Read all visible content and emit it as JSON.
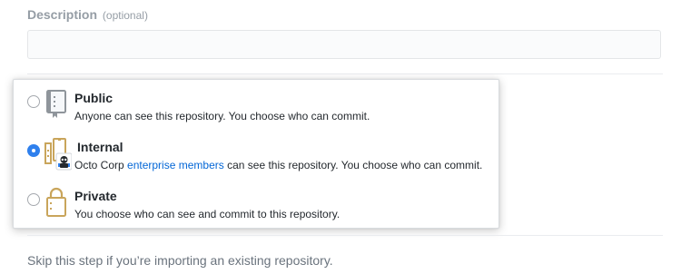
{
  "description_field": {
    "label": "Description",
    "optional_hint": "(optional)",
    "value": "",
    "placeholder": ""
  },
  "visibility": {
    "selected": "internal",
    "options": [
      {
        "id": "public",
        "title": "Public",
        "description": "Anyone can see this repository. You choose who can commit.",
        "icon": "repo-book-icon"
      },
      {
        "id": "internal",
        "title": "Internal",
        "description_prefix": "Octo Corp",
        "description_link": "enterprise members",
        "description_suffix": "can see this repository. You choose who can commit.",
        "icon": "internal-repo-icon"
      },
      {
        "id": "private",
        "title": "Private",
        "description": "You choose who can see and commit to this repository.",
        "icon": "lock-icon"
      }
    ]
  },
  "skip_note": "Skip this step if you’re importing an existing repository.",
  "colors": {
    "accent": "#2f80ed",
    "link": "#0366d6",
    "icon_gold": "#c9a55b",
    "icon_gray": "#8f959b"
  }
}
